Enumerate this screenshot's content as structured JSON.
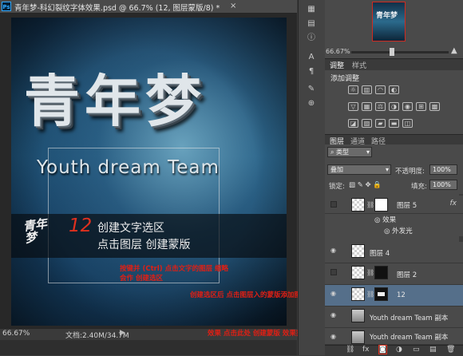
{
  "document": {
    "tab_title": "青年梦-科幻裂纹字体效果.psd @ 66.7% (12, 图层蒙版/8) *",
    "app_badge": "Ps",
    "close_glyph": "×",
    "zoom": "66.67%",
    "doc_size": "文档:2.40M/34.7M",
    "status_arrow": "▶"
  },
  "artwork": {
    "title": "青年梦",
    "subtitle": "Youth dream Team",
    "logo_text": "青年梦",
    "step_number": "12",
    "step_line1": "创建文字选区",
    "step_line2": "点击图层 创建蒙版",
    "annotations": [
      "按键并 (Ctrl) 点击文字的图层 缩略",
      "会作 创建选区",
      "创建选区后 点击图层入的蒙版添加图层",
      "效果 点击此处 创建蒙版 效果实现以上效果"
    ]
  },
  "navigator": {
    "thumb_label": "青年梦",
    "zoom": "66.67%",
    "zoom_slider_fraction": 0.42,
    "zoom_in_glyph": "▲"
  },
  "adjustments_panel": {
    "tabs": [
      "调整",
      "样式"
    ],
    "title": "添加调整",
    "icons": [
      "brightness-contrast-icon",
      "levels-icon",
      "curves-icon",
      "exposure-icon",
      "vibrance-icon",
      "hue-saturation-icon",
      "color-balance-icon",
      "black-white-icon",
      "photo-filter-icon",
      "channel-mixer-icon",
      "color-lookup-icon",
      "invert-icon",
      "posterize-icon",
      "threshold-icon",
      "gradient-map-icon",
      "selective-color-icon"
    ]
  },
  "layers_panel": {
    "tabs": [
      "图层",
      "通道",
      "路径"
    ],
    "filter_label": "类型",
    "blend_mode": "叠加",
    "opacity_label": "不透明度:",
    "opacity_value": "100%",
    "lock_label": "锁定:",
    "fill_label": "填充:",
    "fill_value": "100%",
    "layers": [
      {
        "name": "图层 5",
        "visible": false,
        "selected": false,
        "fx": true,
        "thumb": "checker",
        "mask": "white"
      },
      {
        "name": "效果",
        "sub": true
      },
      {
        "name": "外发光",
        "sub": true
      },
      {
        "name": "图层 4",
        "visible": true,
        "selected": false,
        "fx": false,
        "thumb": "checker"
      },
      {
        "name": "图层 2",
        "visible": false,
        "selected": false,
        "fx": false,
        "thumb": "checker",
        "mask": "black"
      },
      {
        "name": "12",
        "visible": true,
        "selected": true,
        "fx": false,
        "thumb": "checker",
        "mask": "mask"
      },
      {
        "name": "Youth dream Team 副本",
        "visible": true,
        "selected": false,
        "fx": false,
        "thumb": "teamthumb"
      },
      {
        "name": "Youth dream Team 副本",
        "visible": true,
        "selected": false,
        "fx": false,
        "thumb": "teamthumb"
      }
    ],
    "fx_label": "fx",
    "bottom_icons": [
      "link-icon",
      "fx-icon",
      "add-mask-icon",
      "adjustment-layer-icon",
      "group-icon",
      "new-layer-icon",
      "trash-icon"
    ]
  },
  "colors": {
    "accent_red": "#e0301e",
    "selection_blue": "#556f8a"
  }
}
